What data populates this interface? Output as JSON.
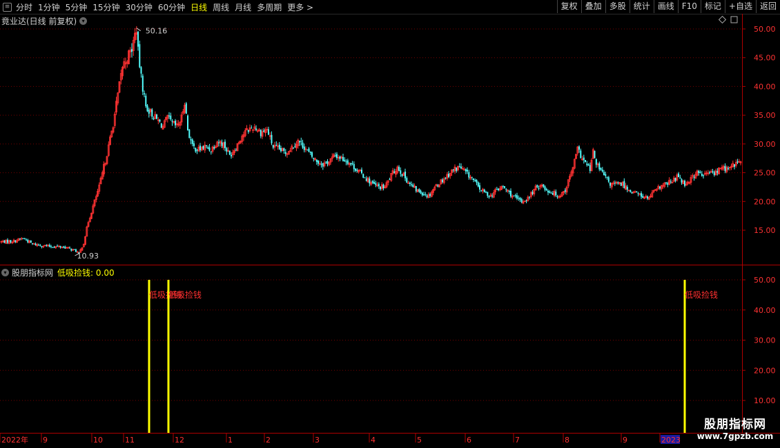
{
  "toolbar": {
    "left_items": [
      "分时",
      "1分钟",
      "5分钟",
      "15分钟",
      "30分钟",
      "60分钟",
      "日线",
      "周线",
      "月线",
      "多周期",
      "更多 >"
    ],
    "active_index": 6,
    "right_items": [
      "复权",
      "叠加",
      "多股",
      "统计",
      "画线",
      "F10",
      "标记",
      "+自选",
      "返回"
    ]
  },
  "main_panel": {
    "title": "竟业达(日线 前复权)",
    "high_label": "50.16",
    "low_label": "10.93",
    "y_ticks": [
      "50.00",
      "45.00",
      "40.00",
      "35.00",
      "30.00",
      "25.00",
      "20.00",
      "15.00"
    ]
  },
  "indicator_panel": {
    "name": "股朋指标网",
    "indicator_label": "低吸捡钱: 0.00",
    "signal_text": "低吸捡钱",
    "y_ticks": [
      "50.00",
      "40.00",
      "30.00",
      "20.00",
      "10.00"
    ]
  },
  "time_axis": {
    "labels": [
      "2022年",
      "9",
      "10",
      "11",
      "12",
      "1",
      "2",
      "3",
      "4",
      "5",
      "6",
      "7",
      "8",
      "9",
      "2023"
    ]
  },
  "watermark": {
    "line1": "股朋指标网",
    "line2": "www.7gpzb.com"
  },
  "colors": {
    "up": "#ff3232",
    "down": "#54ffff",
    "grid": "#7a0000",
    "axis_border": "#b00000",
    "signal": "#ffff00",
    "label_yellow": "#ffff00"
  },
  "chart_data": {
    "type": "candlestick",
    "price_range": [
      11,
      51
    ],
    "trend_series": {
      "name": "close",
      "points": [
        [
          0,
          13.0
        ],
        [
          8,
          13.1
        ],
        [
          14,
          13.6
        ],
        [
          20,
          12.6
        ],
        [
          30,
          12.2
        ],
        [
          40,
          12.1
        ],
        [
          48,
          11.4
        ],
        [
          50,
          10.93
        ],
        [
          53,
          12.8
        ],
        [
          56,
          16.5
        ],
        [
          60,
          20.0
        ],
        [
          63,
          22.5
        ],
        [
          66,
          26.0
        ],
        [
          69,
          29.5
        ],
        [
          72,
          33.5
        ],
        [
          75,
          38.5
        ],
        [
          78,
          43.5
        ],
        [
          81,
          45.0
        ],
        [
          84,
          46.5
        ],
        [
          86,
          49.0
        ],
        [
          87,
          50.16
        ],
        [
          88,
          46.0
        ],
        [
          90,
          41.5
        ],
        [
          93,
          36.5
        ],
        [
          96,
          35.5
        ],
        [
          99,
          34.5
        ],
        [
          101,
          34.0
        ],
        [
          104,
          33.0
        ],
        [
          107,
          34.5
        ],
        [
          110,
          33.5
        ],
        [
          113,
          33.0
        ],
        [
          116,
          34.5
        ],
        [
          118,
          37.5
        ],
        [
          120,
          32.5
        ],
        [
          123,
          29.5
        ],
        [
          127,
          29.0
        ],
        [
          131,
          29.5
        ],
        [
          135,
          29.0
        ],
        [
          139,
          30.5
        ],
        [
          143,
          30.0
        ],
        [
          147,
          28.0
        ],
        [
          151,
          29.5
        ],
        [
          155,
          31.5
        ],
        [
          159,
          32.5
        ],
        [
          163,
          33.0
        ],
        [
          167,
          32.0
        ],
        [
          171,
          32.5
        ],
        [
          175,
          29.5
        ],
        [
          179,
          29.0
        ],
        [
          183,
          28.5
        ],
        [
          187,
          29.5
        ],
        [
          191,
          30.5
        ],
        [
          195,
          29.5
        ],
        [
          199,
          28.0
        ],
        [
          203,
          27.0
        ],
        [
          207,
          26.5
        ],
        [
          211,
          27.0
        ],
        [
          215,
          28.0
        ],
        [
          219,
          27.5
        ],
        [
          223,
          27.0
        ],
        [
          227,
          26.0
        ],
        [
          231,
          25.0
        ],
        [
          235,
          24.0
        ],
        [
          239,
          23.0
        ],
        [
          243,
          22.5
        ],
        [
          247,
          22.5
        ],
        [
          251,
          24.5
        ],
        [
          255,
          26.0
        ],
        [
          259,
          24.5
        ],
        [
          263,
          23.0
        ],
        [
          267,
          22.0
        ],
        [
          271,
          21.5
        ],
        [
          275,
          21.0
        ],
        [
          279,
          22.5
        ],
        [
          283,
          23.5
        ],
        [
          287,
          24.5
        ],
        [
          291,
          25.5
        ],
        [
          295,
          26.0
        ],
        [
          299,
          25.0
        ],
        [
          303,
          24.0
        ],
        [
          307,
          22.5
        ],
        [
          311,
          21.5
        ],
        [
          315,
          21.0
        ],
        [
          319,
          22.0
        ],
        [
          323,
          22.5
        ],
        [
          327,
          21.5
        ],
        [
          331,
          20.5
        ],
        [
          335,
          20.0
        ],
        [
          339,
          20.5
        ],
        [
          343,
          22.0
        ],
        [
          347,
          23.0
        ],
        [
          351,
          22.0
        ],
        [
          355,
          21.5
        ],
        [
          359,
          21.0
        ],
        [
          363,
          22.0
        ],
        [
          367,
          25.0
        ],
        [
          371,
          29.0
        ],
        [
          375,
          27.0
        ],
        [
          379,
          25.5
        ],
        [
          381,
          28.5
        ],
        [
          384,
          26.0
        ],
        [
          388,
          24.5
        ],
        [
          392,
          23.0
        ],
        [
          396,
          23.0
        ],
        [
          400,
          23.0
        ],
        [
          404,
          22.0
        ],
        [
          408,
          21.5
        ],
        [
          412,
          21.0
        ],
        [
          416,
          20.5
        ],
        [
          420,
          21.5
        ],
        [
          424,
          22.5
        ],
        [
          428,
          23.0
        ],
        [
          432,
          23.5
        ],
        [
          436,
          24.5
        ],
        [
          440,
          23.0
        ],
        [
          444,
          24.0
        ],
        [
          448,
          25.0
        ],
        [
          452,
          24.5
        ],
        [
          456,
          25.0
        ],
        [
          460,
          25.0
        ],
        [
          464,
          26.0
        ],
        [
          468,
          25.5
        ],
        [
          472,
          26.5
        ],
        [
          476,
          27.0
        ]
      ]
    },
    "signals": [
      {
        "value": 50
      },
      {
        "value": 50
      },
      {
        "value": 50
      }
    ]
  }
}
